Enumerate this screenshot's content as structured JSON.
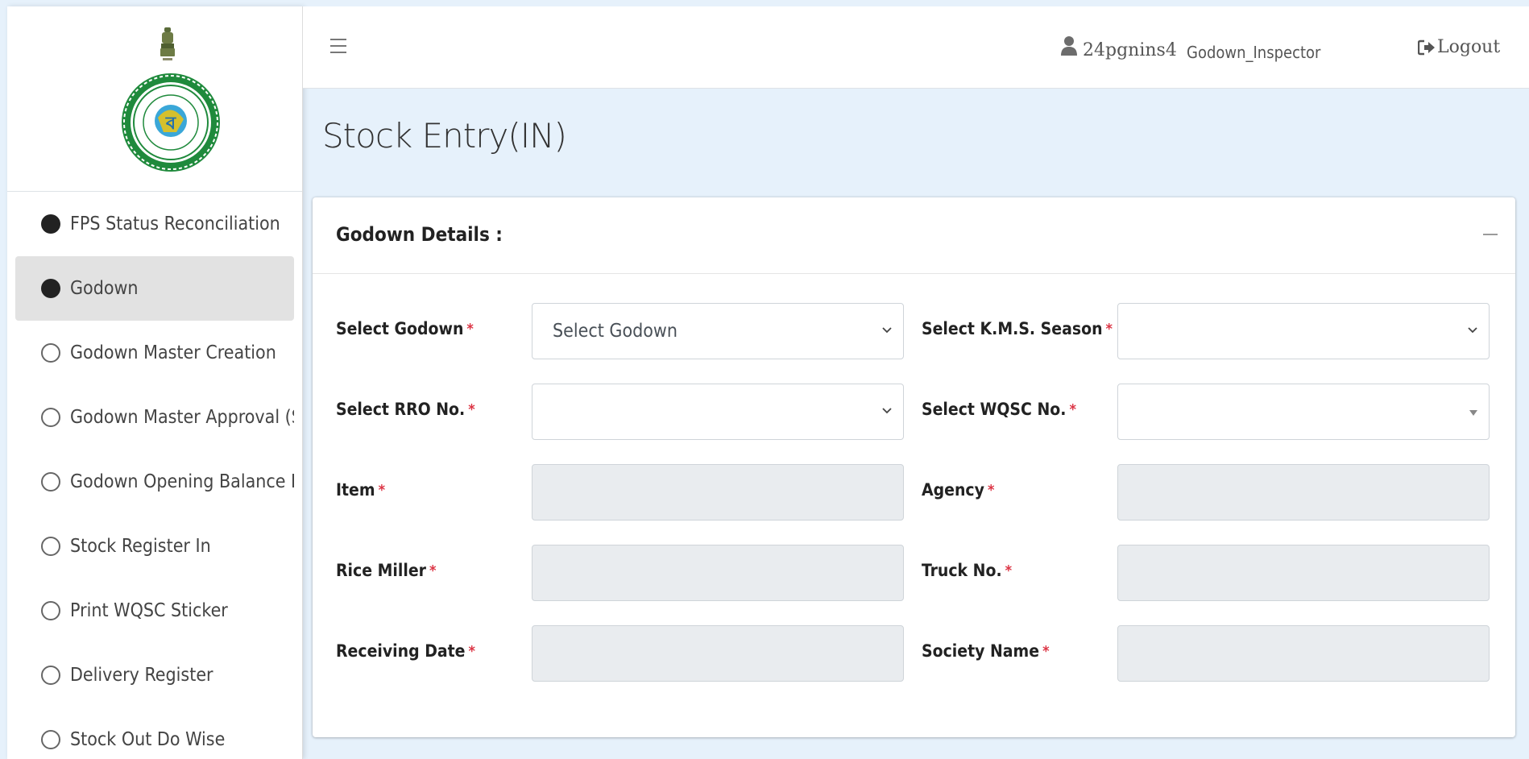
{
  "topbar": {
    "username": "24pgnins4",
    "role": "Godown_Inspector",
    "logout_label": "Logout"
  },
  "sidebar": {
    "items": [
      {
        "label": "FPS Status Reconciliation",
        "state": "filled"
      },
      {
        "label": "Godown",
        "state": "filled",
        "active": true
      },
      {
        "label": "Godown Master Creation",
        "state": "outline"
      },
      {
        "label": "Godown Master Approval (Se",
        "state": "outline"
      },
      {
        "label": "Godown Opening Balance Er",
        "state": "outline"
      },
      {
        "label": "Stock Register In",
        "state": "outline"
      },
      {
        "label": "Print WQSC Sticker",
        "state": "outline"
      },
      {
        "label": "Delivery Register",
        "state": "outline"
      },
      {
        "label": "Stock Out Do Wise",
        "state": "outline"
      }
    ]
  },
  "page": {
    "title": "Stock Entry(IN)"
  },
  "card": {
    "title": "Godown Details :",
    "required_mark": "*",
    "fields": {
      "select_godown": {
        "label": "Select Godown",
        "value": "Select Godown"
      },
      "select_kms_season": {
        "label": "Select K.M.S. Season",
        "value": ""
      },
      "select_rro_no": {
        "label": "Select RRO No.",
        "value": ""
      },
      "select_wqsc_no": {
        "label": "Select WQSC No.",
        "value": ""
      },
      "item": {
        "label": "Item",
        "value": ""
      },
      "agency": {
        "label": "Agency",
        "value": ""
      },
      "rice_miller": {
        "label": "Rice Miller",
        "value": ""
      },
      "truck_no": {
        "label": "Truck No.",
        "value": ""
      },
      "receiving_date": {
        "label": "Receiving Date",
        "value": ""
      },
      "society_name": {
        "label": "Society Name",
        "value": ""
      }
    }
  },
  "colors": {
    "page_bg": "#e6f1fb",
    "required": "#dc3545",
    "seal_green": "#1f8a3c",
    "disabled_input": "#e9ecef"
  },
  "icons": [
    "menu-icon",
    "user-icon",
    "logout-icon",
    "chevron-down-icon",
    "caret-down-icon",
    "minus-icon",
    "state-emblem-icon",
    "west-bengal-seal-icon"
  ]
}
